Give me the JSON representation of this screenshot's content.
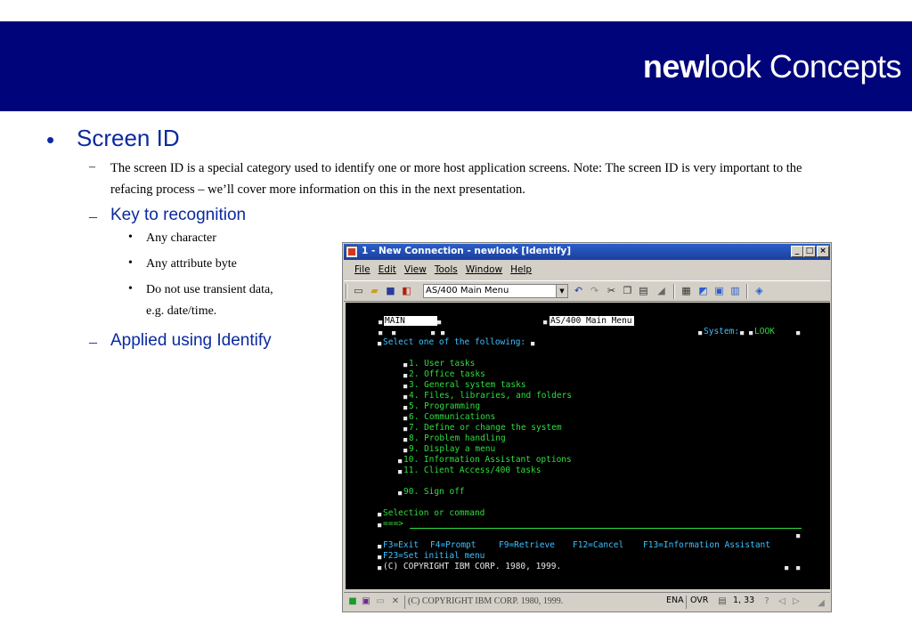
{
  "slide": {
    "title_bold": "new",
    "title_rest": "look Concepts",
    "bullet_main": "Screen ID",
    "bullet_dot": "•",
    "dash": "–",
    "description": "The screen ID is a special category used to identify one or more host application screens. Note: The screen ID is very important to the refacing process – we’ll cover more information on this in the next presentation.",
    "key_heading": "Key to recognition",
    "key_items": [
      "Any character",
      "Any attribute byte",
      "Do not use transient data, e.g. date/time."
    ],
    "applied": "Applied using Identify"
  },
  "window": {
    "title": "1 - New Connection - newlook [Identify]",
    "controls": {
      "minimize": "_",
      "maximize": "□",
      "close": "×"
    },
    "menu": [
      "File",
      "Edit",
      "View",
      "Tools",
      "Window",
      "Help"
    ],
    "toolbar": {
      "screen_select": "AS/400 Main Menu",
      "dropdown_arrow": "▼"
    }
  },
  "terminal": {
    "main_field": "MAIN",
    "menu_field": "AS/400 Main Menu",
    "system_label": "System:",
    "system_value": "LOOK",
    "select_prompt": "Select one of the following:",
    "options": [
      "1. User tasks",
      "2. Office tasks",
      "3. General system tasks",
      "4. Files, libraries, and folders",
      "5. Programming",
      "6. Communications",
      "7. Define or change the system",
      "8. Problem handling",
      "9. Display a menu",
      "10. Information Assistant options",
      "11. Client Access/400 tasks",
      "90. Sign off"
    ],
    "selection_label": "Selection or command",
    "prompt_arrow": "===>",
    "fkeys_line1": [
      "F3=Exit",
      "F4=Prompt",
      "F9=Retrieve",
      "F12=Cancel",
      "F13=Information Assistant"
    ],
    "fkeys_line2": "F23=Set initial menu",
    "copyright": "(C) COPYRIGHT IBM CORP. 1980, 1999.",
    "marker": "■"
  },
  "statusbar": {
    "message": "(C) COPYRIGHT IBM CORP. 1980, 1999.",
    "lang": "ENA",
    "mode": "OVR",
    "cursor": "1, 33"
  },
  "colors": {
    "header_bg": "#00047b",
    "slide_blue": "#0b2a9e",
    "terminal_green": "#2fde3f",
    "terminal_cyan": "#3ec0ff"
  }
}
